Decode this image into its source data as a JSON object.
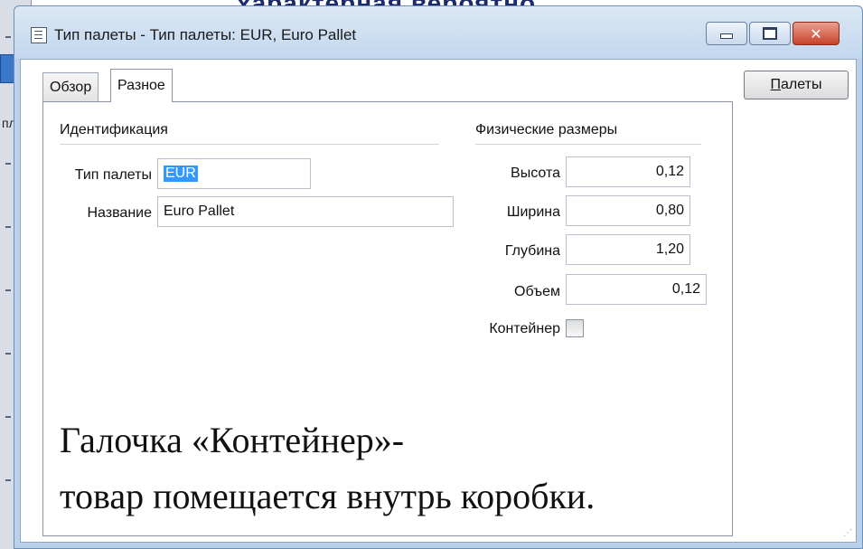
{
  "background": {
    "left_fragment": "пле",
    "top_fragment": "характерная вероятно"
  },
  "window": {
    "title": "Тип палеты - Тип палеты: EUR, Euro Pallet",
    "close_glyph": "✕"
  },
  "tabs": [
    {
      "label": "Обзор",
      "active": false
    },
    {
      "label": "Разное",
      "active": true
    }
  ],
  "side_button": {
    "label_prefix": "",
    "label_underlined": "П",
    "label_rest": "алеты"
  },
  "identification": {
    "group_label": "Идентификация",
    "pallet_type_label": "Тип палеты",
    "pallet_type_value": "EUR",
    "name_label": "Название",
    "name_value": "Euro Pallet"
  },
  "physical": {
    "group_label": "Физические размеры",
    "height_label": "Высота",
    "height_value": "0,12",
    "width_label": "Ширина",
    "width_value": "0,80",
    "depth_label": "Глубина",
    "depth_value": "1,20",
    "volume_label": "Объем",
    "volume_value": "0,12",
    "container_label": "Контейнер",
    "container_checked": false
  },
  "note": {
    "line1": "Галочка «Контейнер»-",
    "line2": "товар помещается внутрь коробки."
  },
  "colors": {
    "frame": "#b9d1ea",
    "selection": "#3399ff",
    "close_button": "#c8422a"
  }
}
